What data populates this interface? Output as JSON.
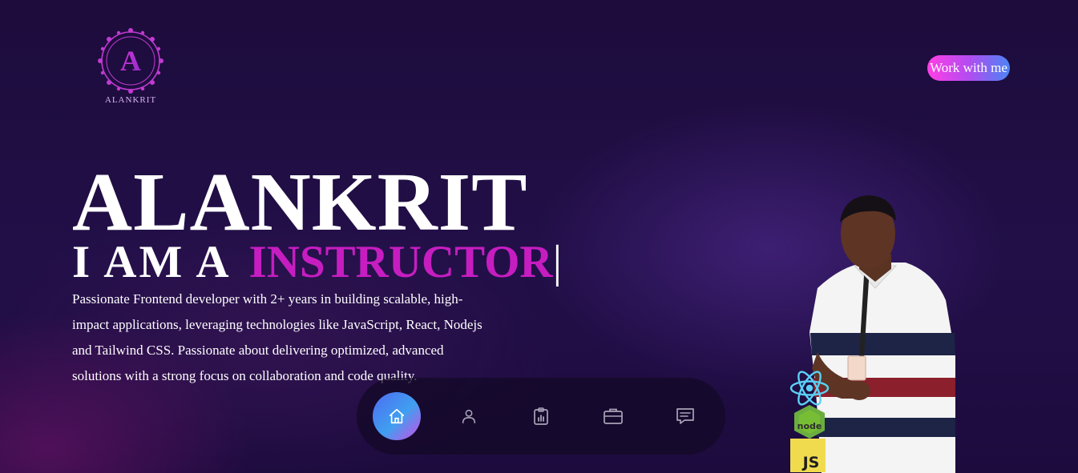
{
  "brand": {
    "logo_letter": "A",
    "logo_text": "ALANKRIT",
    "accent_color": "#c61dc1"
  },
  "header": {
    "cta_label": "Work with me"
  },
  "hero": {
    "name": "ALANKRIT",
    "role_prefix": "I AM A",
    "role_word": "INSTRUCTOR",
    "cursor": "|",
    "description": "Passionate Frontend developer with 2+ years in building scalable, high-impact applications, leveraging technologies like JavaScript, React, Nodejs and Tailwind CSS. Passionate about delivering optimized, advanced solutions with a strong focus on collaboration and code quality."
  },
  "nav": {
    "items": [
      {
        "icon": "home-icon",
        "active": true
      },
      {
        "icon": "user-icon",
        "active": false
      },
      {
        "icon": "clipboard-chart-icon",
        "active": false
      },
      {
        "icon": "briefcase-icon",
        "active": false
      },
      {
        "icon": "message-icon",
        "active": false
      }
    ]
  },
  "tech_badges": {
    "items": [
      {
        "icon": "react-icon"
      },
      {
        "icon": "nodejs-icon",
        "text": "node"
      },
      {
        "icon": "javascript-icon",
        "text": "JS"
      }
    ]
  }
}
